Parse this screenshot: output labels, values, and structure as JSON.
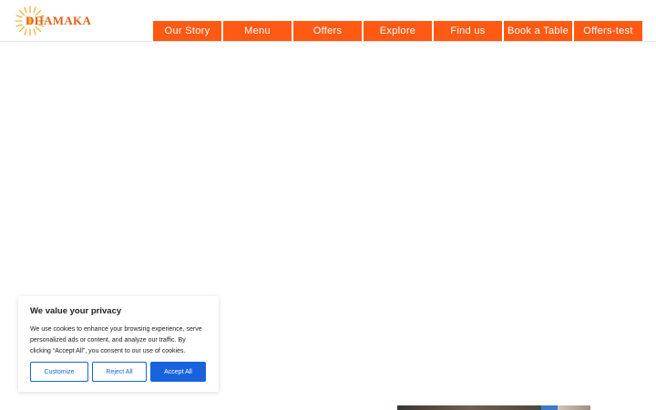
{
  "brand": {
    "name": "DHAMAKA",
    "color": "#e2621b"
  },
  "nav": {
    "color": "#ff5a14",
    "items": [
      {
        "label": "Our Story"
      },
      {
        "label": "Menu"
      },
      {
        "label": "Offers"
      },
      {
        "label": "Explore"
      },
      {
        "label": "Find us"
      },
      {
        "label": "Book a Table"
      },
      {
        "label": "Offers-test"
      }
    ]
  },
  "cookie_banner": {
    "title": "We value your privacy",
    "body": "We use cookies to enhance your browsing experience, serve personalized ads or content, and analyze our traffic. By clicking “Accept All”, you consent to our use of cookies.",
    "buttons": {
      "customize": "Customize",
      "reject": "Reject All",
      "accept": "Accept All"
    },
    "accent_color": "#1863dc"
  }
}
